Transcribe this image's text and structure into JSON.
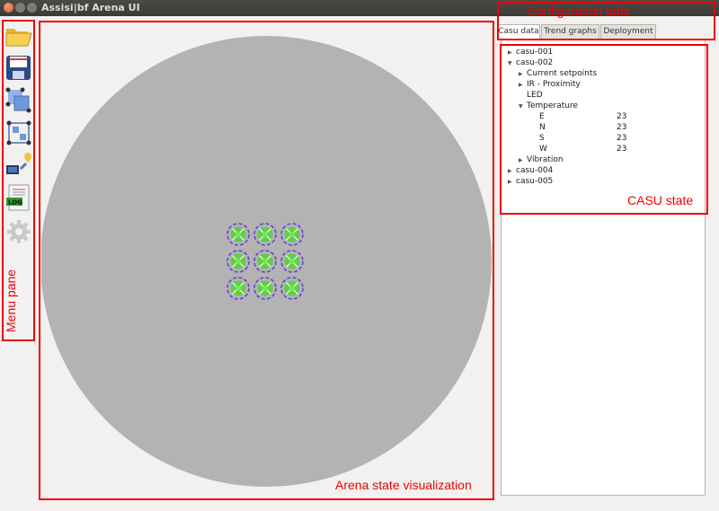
{
  "window": {
    "title": "Assisi|bf Arena UI"
  },
  "menu": {
    "tools": [
      {
        "name": "open-folder-icon",
        "label": "Open"
      },
      {
        "name": "save-icon",
        "label": "Save"
      },
      {
        "name": "select-icon",
        "label": "Select"
      },
      {
        "name": "group-select-icon",
        "label": "Group"
      },
      {
        "name": "deploy-icon",
        "label": "Deploy"
      },
      {
        "name": "log-icon",
        "label": "LOG"
      },
      {
        "name": "gear-icon",
        "label": "Settings"
      }
    ]
  },
  "tabs": [
    {
      "label": "Casu data",
      "active": true
    },
    {
      "label": "Trend graphs",
      "active": false
    },
    {
      "label": "Deployment",
      "active": false
    }
  ],
  "tree": {
    "casu_001": "casu-001",
    "casu_002": "casu-002",
    "current_setpoints": "Current setpoints",
    "ir_proximity": "IR - Proximity",
    "led": "LED",
    "temperature": "Temperature",
    "temps": [
      {
        "label": "E",
        "value": "23"
      },
      {
        "label": "N",
        "value": "23"
      },
      {
        "label": "S",
        "value": "23"
      },
      {
        "label": "W",
        "value": "23"
      }
    ],
    "vibration": "Vibration",
    "casu_004": "casu-004",
    "casu_005": "casu-005"
  },
  "annotations": {
    "config_tabs": "Configuration tabs",
    "casu_state": "CASU state",
    "arena": "Arena state visualization",
    "menu": "Menu pane"
  },
  "colors": {
    "arena_disc": "#b3b3b3",
    "casu_green": "#5fcf45",
    "casu_ring": "#6a3fd8",
    "annotation_red": "#f00000"
  }
}
